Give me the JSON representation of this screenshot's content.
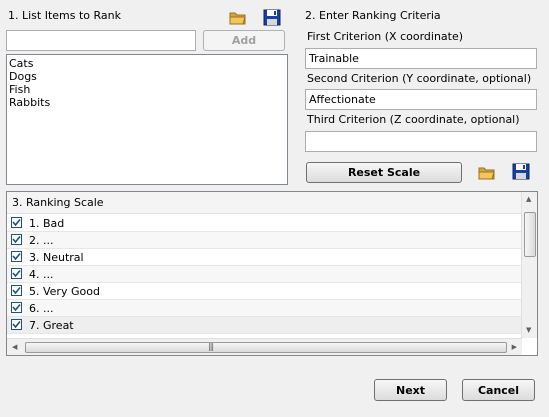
{
  "section1": {
    "title": "1. List Items to Rank",
    "input_value": "",
    "add_label": "Add",
    "items": [
      "Cats",
      "Dogs",
      "Fish",
      "Rabbits"
    ],
    "icons": [
      "folder-open-icon",
      "save-disk-icon"
    ]
  },
  "section2": {
    "title": "2. Enter Ranking Criteria",
    "first_label": "First Criterion (X coordinate)",
    "first_value": "Trainable",
    "second_label": "Second Criterion (Y coordinate, optional)",
    "second_value": "Affectionate",
    "third_label": "Third Criterion (Z coordinate, optional)",
    "third_value": "",
    "reset_label": "Reset Scale"
  },
  "section3": {
    "title": "3. Ranking Scale",
    "rows": [
      {
        "label": "1. Bad",
        "checked": true
      },
      {
        "label": "2. ...",
        "checked": true
      },
      {
        "label": "3. Neutral",
        "checked": true
      },
      {
        "label": "4. ...",
        "checked": true
      },
      {
        "label": "5. Very Good",
        "checked": true
      },
      {
        "label": "6. ...",
        "checked": true
      },
      {
        "label": "7. Great",
        "checked": true
      }
    ]
  },
  "footer": {
    "next_label": "Next",
    "cancel_label": "Cancel"
  },
  "colors": {
    "folder": "#e8b84a",
    "disk": "#1a3fa0",
    "check": "#1c5180"
  }
}
